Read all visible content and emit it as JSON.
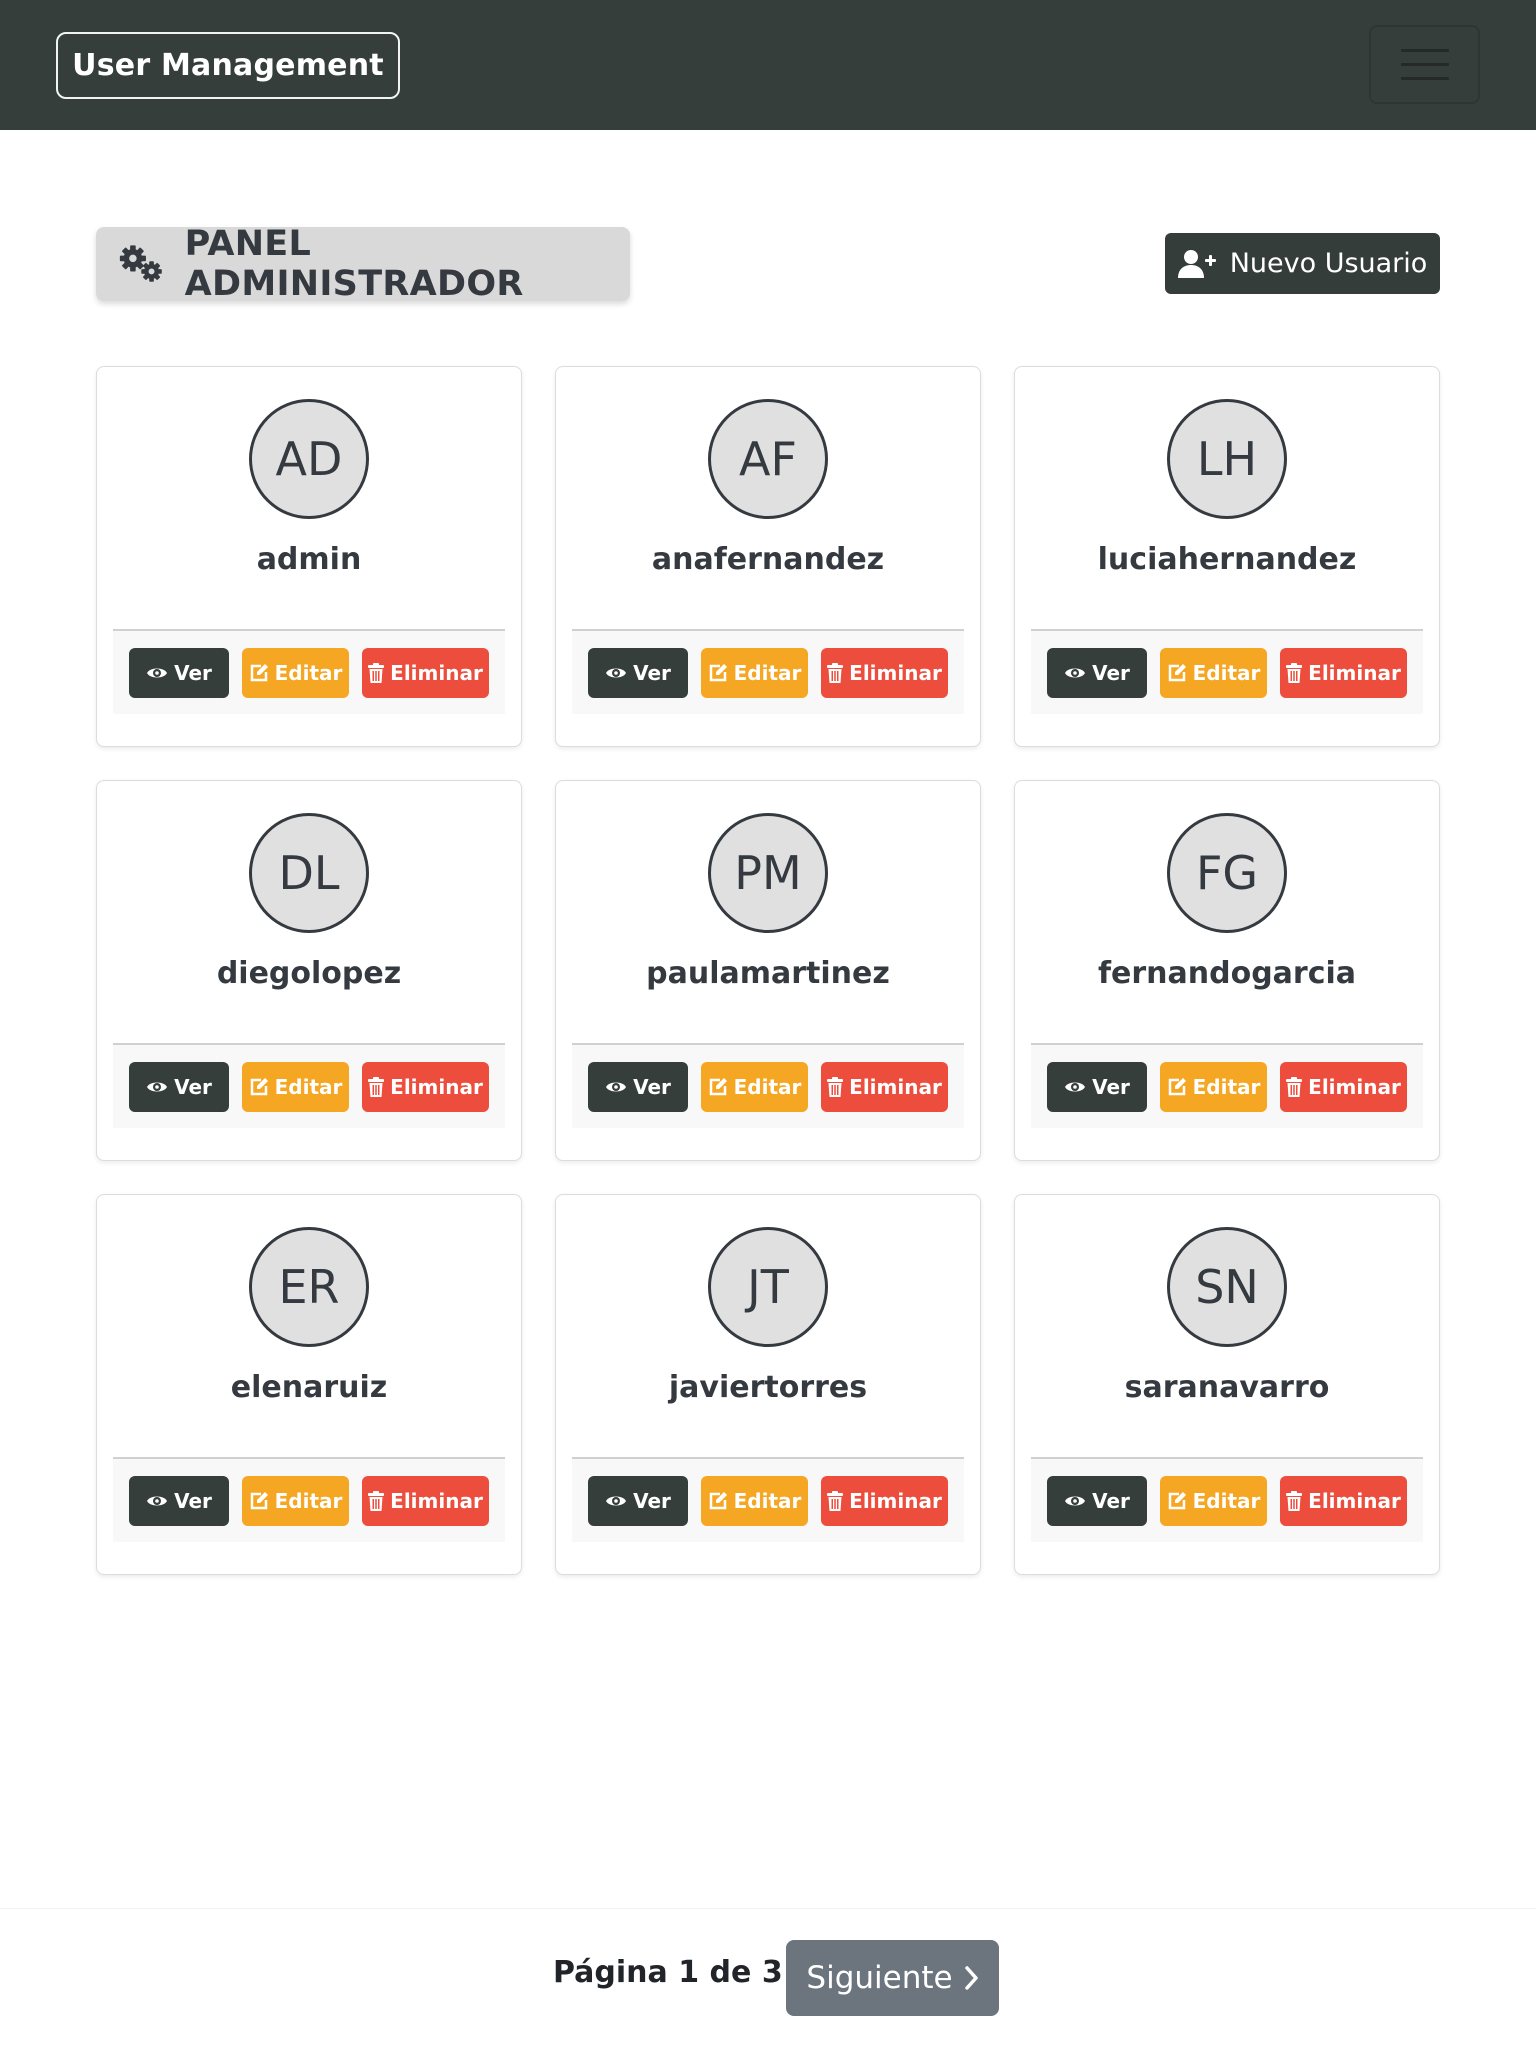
{
  "navbar": {
    "brand": "User Management",
    "menu_icon": "hamburger-menu-icon"
  },
  "header": {
    "title": "PANEL ADMINISTRADOR",
    "title_icon": "gears-icon",
    "new_user_label": "Nuevo Usuario",
    "new_user_icon": "user-plus-icon"
  },
  "actions": {
    "view_label": "Ver",
    "edit_label": "Editar",
    "delete_label": "Eliminar"
  },
  "users": [
    {
      "initials": "AD",
      "username": "admin"
    },
    {
      "initials": "AF",
      "username": "anafernandez"
    },
    {
      "initials": "LH",
      "username": "luciahernandez"
    },
    {
      "initials": "DL",
      "username": "diegolopez"
    },
    {
      "initials": "PM",
      "username": "paulamartinez"
    },
    {
      "initials": "FG",
      "username": "fernandogarcia"
    },
    {
      "initials": "ER",
      "username": "elenaruiz"
    },
    {
      "initials": "JT",
      "username": "javiertorres"
    },
    {
      "initials": "SN",
      "username": "saranavarro"
    }
  ],
  "pagination": {
    "status": "Página 1 de 3",
    "next_label": "Siguiente"
  },
  "colors": {
    "navbar": "#363e3c",
    "view": "#363e3c",
    "edit": "#f5a623",
    "delete": "#ec4d3c",
    "next": "#6c757d"
  }
}
